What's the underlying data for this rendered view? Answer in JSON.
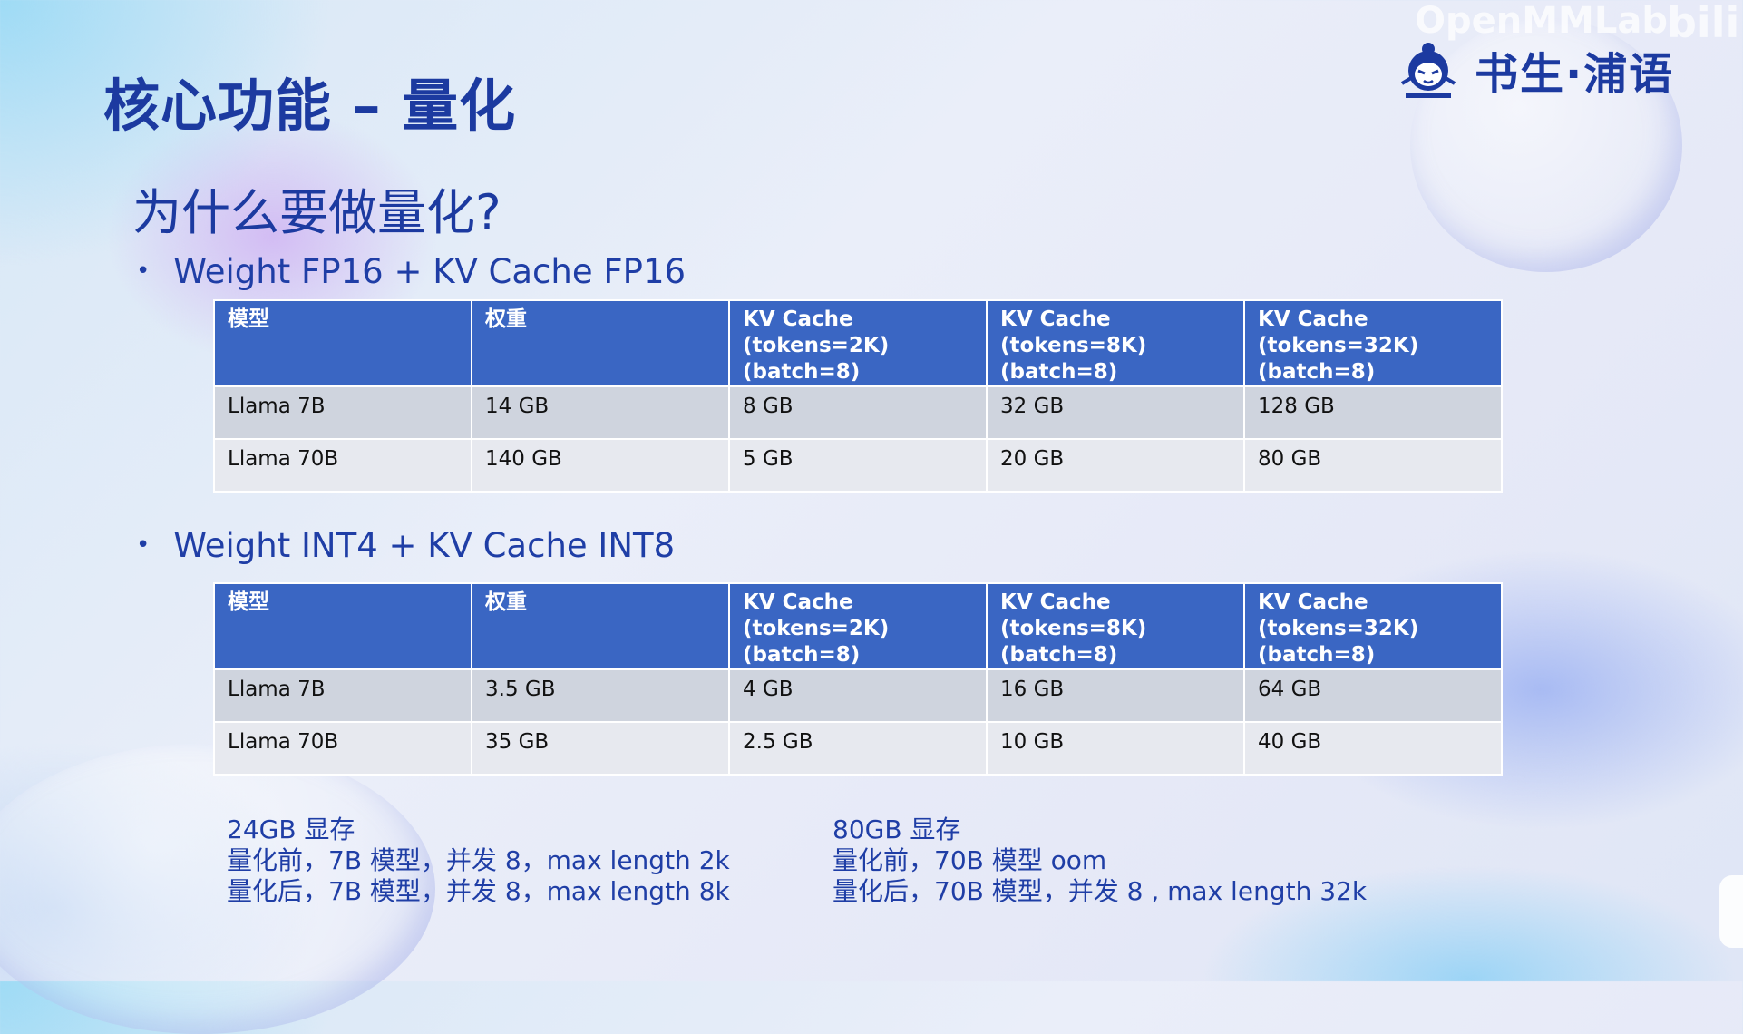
{
  "watermark": {
    "text": "OpenMMLab",
    "bili": "bili"
  },
  "logo": {
    "icon": "scholar-mascot-icon",
    "text": "书生·浦语"
  },
  "slide": {
    "title": "核心功能 – 量化",
    "subtitle": "为什么要做量化?"
  },
  "section1": {
    "bullet": "Weight FP16 + KV Cache FP16",
    "headers": [
      [
        "模型"
      ],
      [
        "权重"
      ],
      [
        "KV Cache",
        "(tokens=2K)",
        "(batch=8)"
      ],
      [
        "KV Cache",
        "(tokens=8K)",
        "(batch=8)"
      ],
      [
        "KV Cache",
        "(tokens=32K)",
        "(batch=8)"
      ]
    ],
    "rows": [
      [
        "Llama 7B",
        "14 GB",
        "8 GB",
        "32 GB",
        "128 GB"
      ],
      [
        "Llama 70B",
        "140 GB",
        "5 GB",
        "20 GB",
        "80 GB"
      ]
    ]
  },
  "section2": {
    "bullet": "Weight INT4 + KV Cache INT8",
    "headers": [
      [
        "模型"
      ],
      [
        "权重"
      ],
      [
        "KV Cache",
        "(tokens=2K)",
        "(batch=8)"
      ],
      [
        "KV Cache",
        "(tokens=8K)",
        "(batch=8)"
      ],
      [
        "KV Cache",
        "(tokens=32K)",
        "(batch=8)"
      ]
    ],
    "rows": [
      [
        "Llama 7B",
        "3.5 GB",
        "4 GB",
        "16 GB",
        "64 GB"
      ],
      [
        "Llama 70B",
        "35 GB",
        "2.5 GB",
        "10 GB",
        "40 GB"
      ]
    ]
  },
  "notes": {
    "left": [
      "24GB 显存",
      "量化前，7B 模型，并发 8，max length 2k",
      "量化后，7B 模型，并发 8，max length 8k"
    ],
    "right": [
      "80GB 显存",
      "量化前，70B 模型 oom",
      "量化后，70B 模型，并发 8 , max length 32k"
    ]
  }
}
